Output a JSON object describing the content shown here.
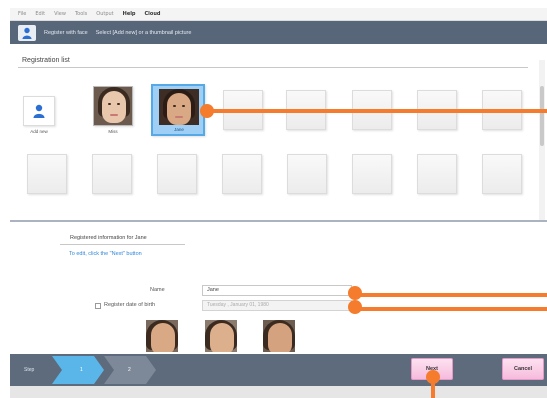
{
  "menu": {
    "items": [
      "File",
      "Edit",
      "View",
      "Tools",
      "Output",
      "Help",
      "Cloud"
    ]
  },
  "title": {
    "main": "Register with face",
    "instruction": "Select [Add new] or a thumbnail picture"
  },
  "registration": {
    "label": "Registration list",
    "add_new_label": "Add new",
    "people": [
      {
        "name": "Miss"
      },
      {
        "name": "Jane"
      }
    ]
  },
  "info": {
    "title": "Registered information for Jane",
    "hint": "To edit, click the \"Next\" button",
    "name_label": "Name",
    "name_value": "Jane",
    "dob_label": "Register date of birth",
    "dob_value": "Tuesday , January  01, 1980"
  },
  "footer": {
    "step_label": "Step",
    "step1": "1",
    "step2": "2",
    "next_label": "Next",
    "cancel_label": "Cancel"
  },
  "colors": {
    "accent": "#f47c2c",
    "selection": "#54a9e6",
    "header": "#58667a",
    "button": "#f6bbdd"
  }
}
